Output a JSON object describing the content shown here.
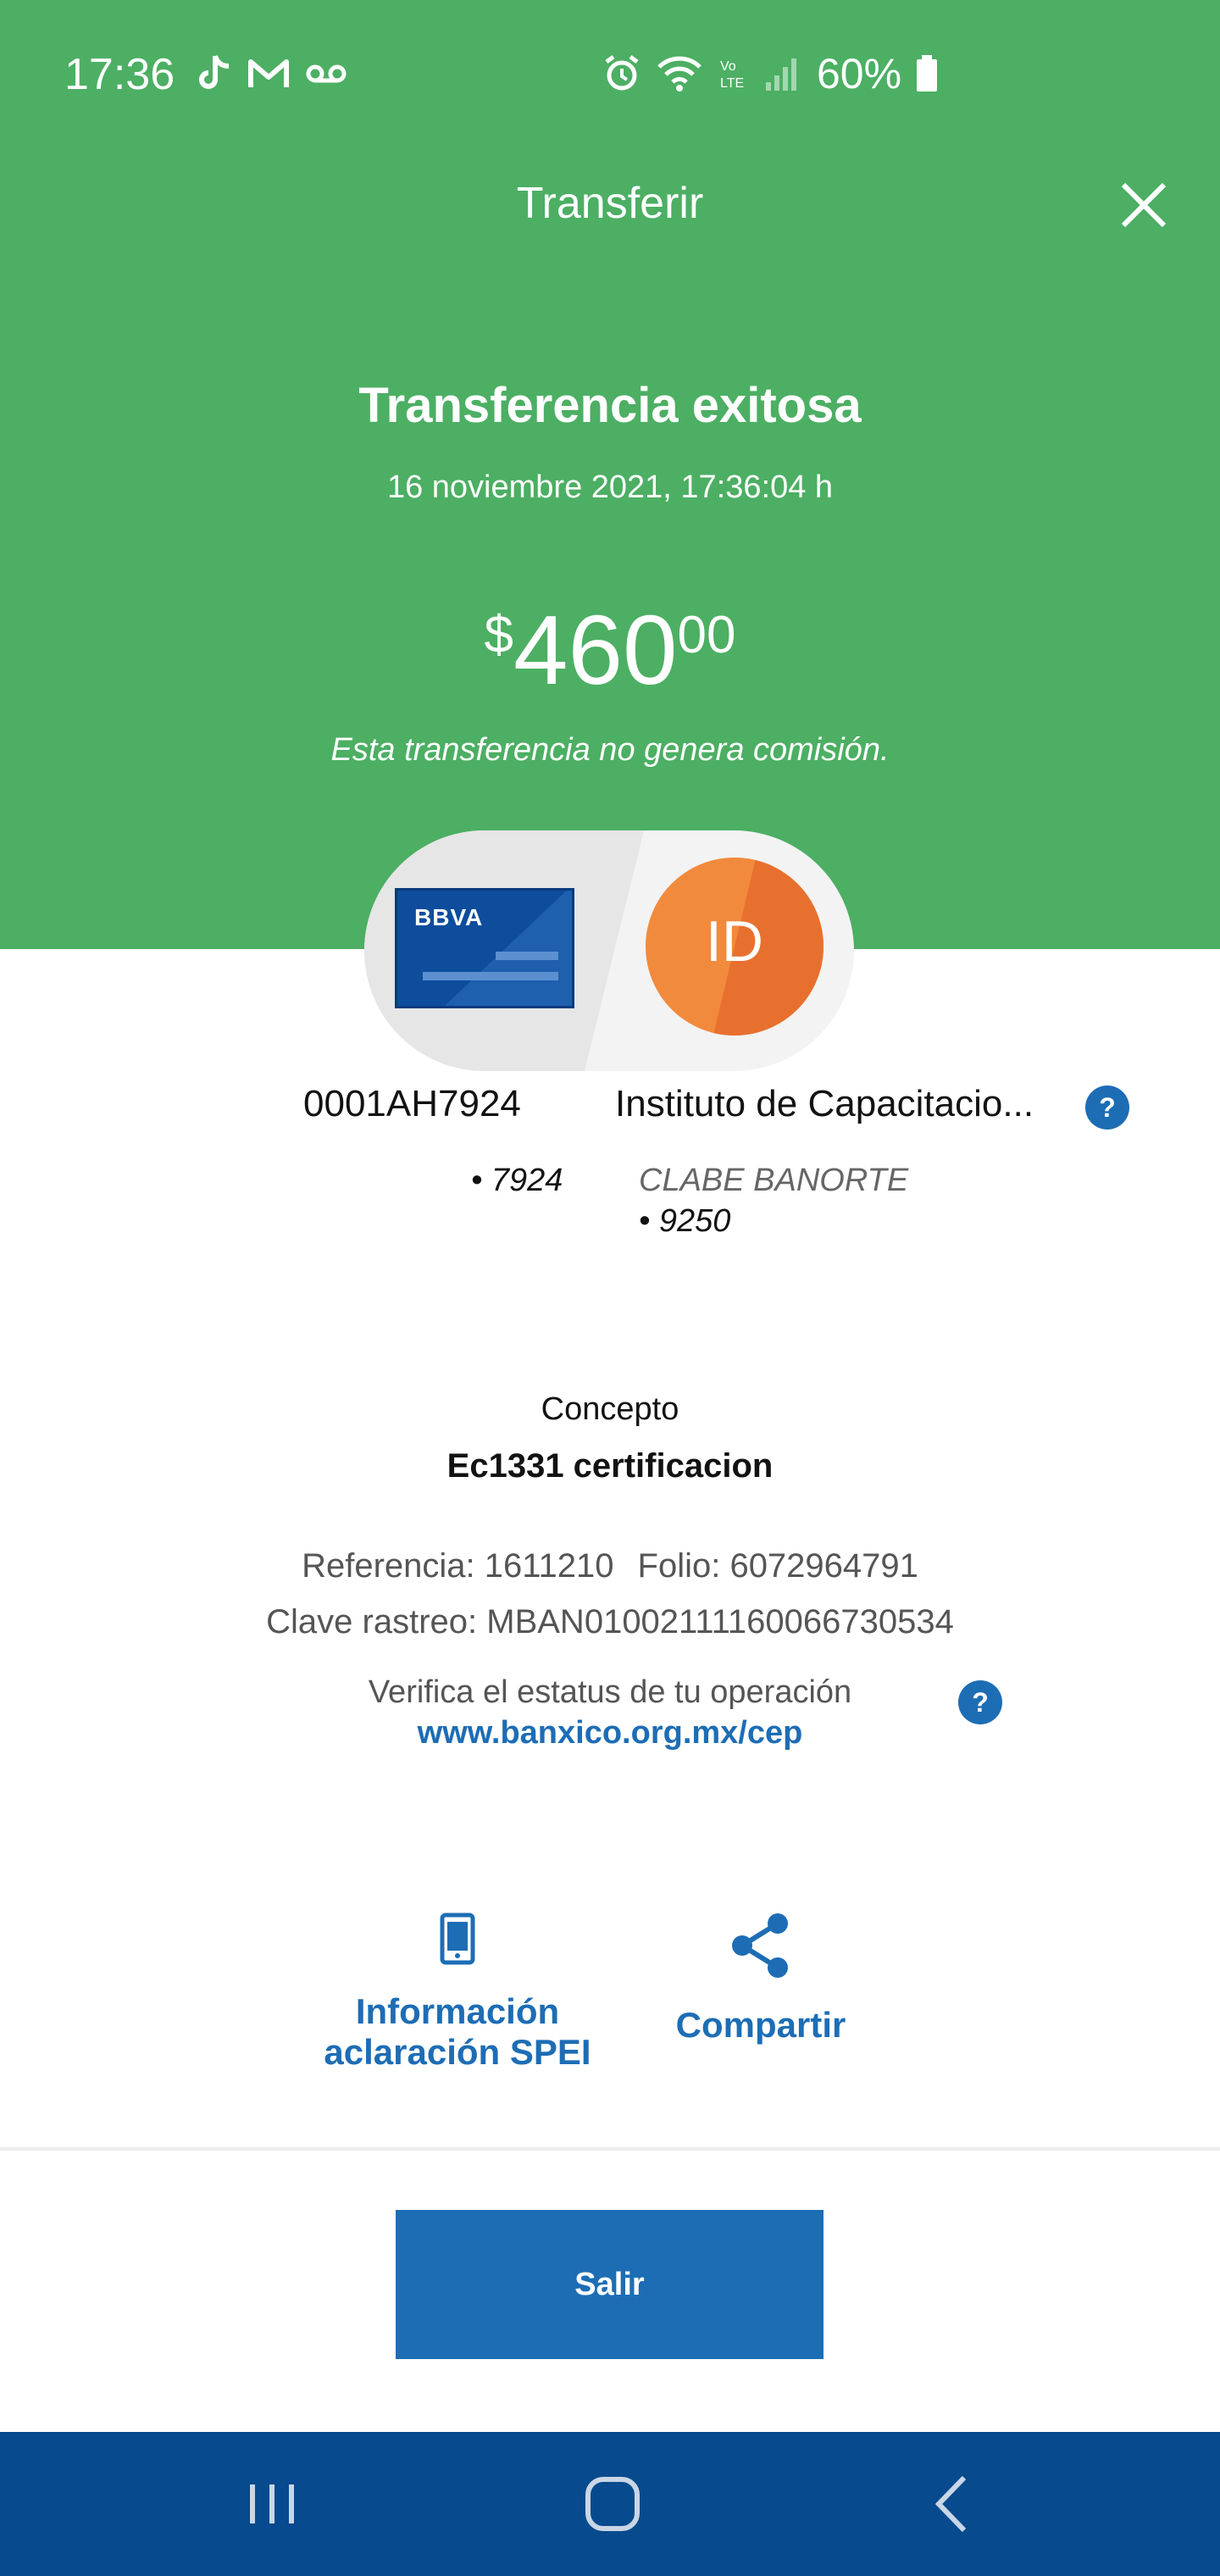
{
  "status_bar": {
    "time": "17:36",
    "left_icons": [
      "tiktok-icon",
      "gmail-icon",
      "voicemail-icon"
    ],
    "right_icons": [
      "alarm-icon",
      "wifi-icon",
      "volte-icon",
      "signal-icon"
    ],
    "battery": "60%"
  },
  "header": {
    "title": "Transferir",
    "close_icon": "close-icon"
  },
  "result": {
    "title": "Transferencia exitosa",
    "datetime": "16 noviembre 2021, 17:36:04 h",
    "amount_currency": "$",
    "amount_integer": "460",
    "amount_decimals": "00",
    "fee_note": "Esta transferencia no genera comisión."
  },
  "origin": {
    "bank_logo": "BBVA",
    "account": "0001AH7924",
    "last_digits": "• 7924"
  },
  "destination": {
    "avatar_initials": "ID",
    "name": "Instituto de Capacitacio...",
    "account_type": "CLABE BANORTE",
    "last_digits": "• 9250"
  },
  "concept": {
    "label": "Concepto",
    "value": "Ec1331 certificacion"
  },
  "details": {
    "reference": "Referencia: 1611210",
    "folio": "Folio: 6072964791",
    "tracking": "Clave rastreo: MBAN01002111160066730534",
    "verify_text": "Verifica el estatus de tu operación",
    "verify_link": "www.banxico.org.mx/cep"
  },
  "actions": {
    "info_line1": "Información",
    "info_line2": "aclaración SPEI",
    "share": "Compartir"
  },
  "footer": {
    "exit_button": "Salir"
  },
  "nav_bar": [
    "recent-apps-icon",
    "home-icon",
    "back-icon"
  ],
  "colors": {
    "header_green": "#4caf63",
    "primary_blue": "#1d6db5",
    "nav_blue": "#074a8d"
  }
}
